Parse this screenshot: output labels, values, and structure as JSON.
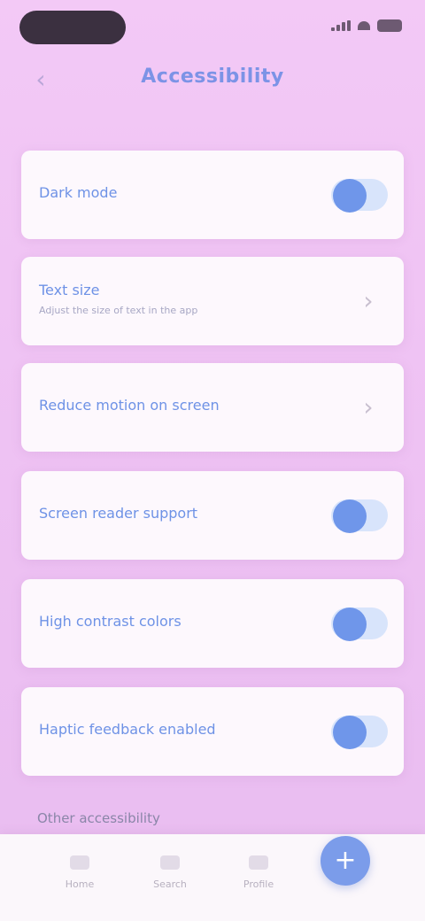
{
  "status_bar": {
    "icons": [
      "signal-icon",
      "wifi-icon",
      "battery-icon"
    ]
  },
  "header": {
    "back_icon": "chevron-left-icon",
    "title": "Accessibility"
  },
  "settings": [
    {
      "label": "Dark mode",
      "control": "toggle",
      "state": "on"
    },
    {
      "label": "Text size",
      "subtitle": "Adjust the size of text in the app",
      "control": "chevron"
    },
    {
      "label": "Reduce motion on screen",
      "control": "chevron"
    },
    {
      "label": "Screen reader support",
      "control": "toggle",
      "state": "on"
    },
    {
      "label": "High contrast colors",
      "control": "toggle",
      "state": "on"
    },
    {
      "label": "Haptic feedback enabled",
      "control": "toggle",
      "state": "on"
    }
  ],
  "partial_label": "Other accessibility",
  "bottom_nav": {
    "items": [
      {
        "label": "Home",
        "icon": "home-icon"
      },
      {
        "label": "Search",
        "icon": "search-icon"
      },
      {
        "label": "Profile",
        "icon": "user-icon"
      }
    ],
    "fab_icon": "plus-icon"
  },
  "colors": {
    "accent": "#6f96ea",
    "background": "#f0c4f4",
    "card": "#fdf8fd"
  }
}
